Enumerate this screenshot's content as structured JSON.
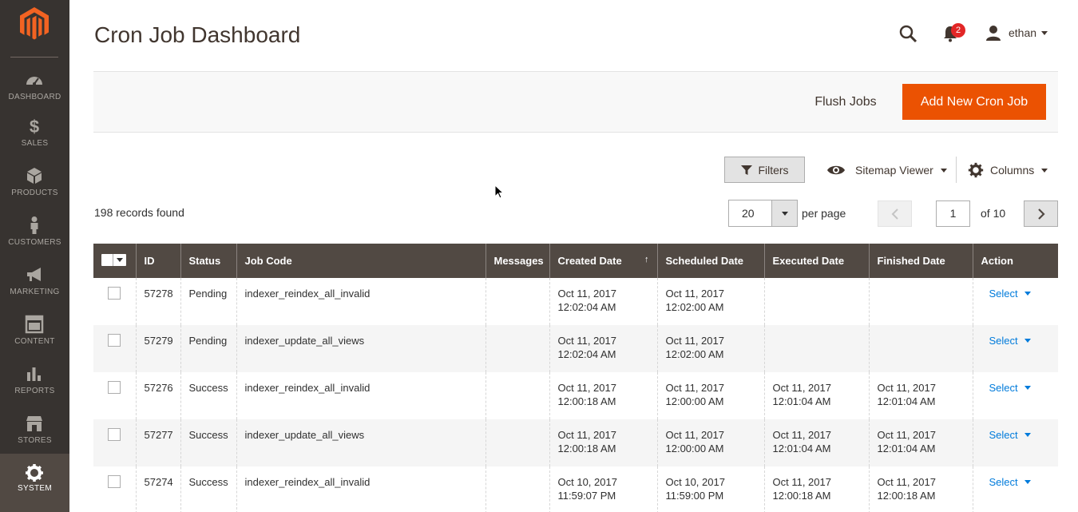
{
  "sidebar": {
    "items": [
      {
        "label": "DASHBOARD",
        "icon": "dashboard-icon"
      },
      {
        "label": "SALES",
        "icon": "dollar-icon"
      },
      {
        "label": "PRODUCTS",
        "icon": "cube-icon"
      },
      {
        "label": "CUSTOMERS",
        "icon": "person-icon"
      },
      {
        "label": "MARKETING",
        "icon": "megaphone-icon"
      },
      {
        "label": "CONTENT",
        "icon": "layout-icon"
      },
      {
        "label": "REPORTS",
        "icon": "bar-chart-icon"
      },
      {
        "label": "STORES",
        "icon": "storefront-icon"
      },
      {
        "label": "SYSTEM",
        "icon": "gear-icon"
      }
    ],
    "active": "SYSTEM"
  },
  "header": {
    "title": "Cron Job Dashboard",
    "notification_count": "2",
    "user_name": "ethan"
  },
  "actions": {
    "flush_label": "Flush Jobs",
    "add_label": "Add New Cron Job"
  },
  "grid_controls": {
    "filters_label": "Filters",
    "view_label": "Sitemap Viewer",
    "columns_label": "Columns",
    "records_found": "198 records found",
    "per_page_value": "20",
    "per_page_label": "per page",
    "current_page": "1",
    "page_total_label": "of 10"
  },
  "table": {
    "columns": [
      "ID",
      "Status",
      "Job Code",
      "Messages",
      "Created Date",
      "Scheduled Date",
      "Executed Date",
      "Finished Date",
      "Action"
    ],
    "sort_indicator": "↑",
    "action_label": "Select",
    "rows": [
      {
        "id": "57278",
        "status": "Pending",
        "job_code": "indexer_reindex_all_invalid",
        "messages": "",
        "created_date": "Oct 11, 2017",
        "created_time": "12:02:04 AM",
        "scheduled_date": "Oct 11, 2017",
        "scheduled_time": "12:02:00 AM",
        "executed_date": "",
        "executed_time": "",
        "finished_date": "",
        "finished_time": ""
      },
      {
        "id": "57279",
        "status": "Pending",
        "job_code": "indexer_update_all_views",
        "messages": "",
        "created_date": "Oct 11, 2017",
        "created_time": "12:02:04 AM",
        "scheduled_date": "Oct 11, 2017",
        "scheduled_time": "12:02:00 AM",
        "executed_date": "",
        "executed_time": "",
        "finished_date": "",
        "finished_time": ""
      },
      {
        "id": "57276",
        "status": "Success",
        "job_code": "indexer_reindex_all_invalid",
        "messages": "",
        "created_date": "Oct 11, 2017",
        "created_time": "12:00:18 AM",
        "scheduled_date": "Oct 11, 2017",
        "scheduled_time": "12:00:00 AM",
        "executed_date": "Oct 11, 2017",
        "executed_time": "12:01:04 AM",
        "finished_date": "Oct 11, 2017",
        "finished_time": "12:01:04 AM"
      },
      {
        "id": "57277",
        "status": "Success",
        "job_code": "indexer_update_all_views",
        "messages": "",
        "created_date": "Oct 11, 2017",
        "created_time": "12:00:18 AM",
        "scheduled_date": "Oct 11, 2017",
        "scheduled_time": "12:00:00 AM",
        "executed_date": "Oct 11, 2017",
        "executed_time": "12:01:04 AM",
        "finished_date": "Oct 11, 2017",
        "finished_time": "12:01:04 AM"
      },
      {
        "id": "57274",
        "status": "Success",
        "job_code": "indexer_reindex_all_invalid",
        "messages": "",
        "created_date": "Oct 10, 2017",
        "created_time": "11:59:07 PM",
        "scheduled_date": "Oct 10, 2017",
        "scheduled_time": "11:59:00 PM",
        "executed_date": "Oct 11, 2017",
        "executed_time": "12:00:18 AM",
        "finished_date": "Oct 11, 2017",
        "finished_time": "12:00:18 AM"
      }
    ]
  },
  "colors": {
    "sidebar_bg": "#373330",
    "accent_orange": "#eb5202",
    "table_header_bg": "#514943",
    "link_blue": "#007bdb",
    "badge_red": "#e22626"
  }
}
